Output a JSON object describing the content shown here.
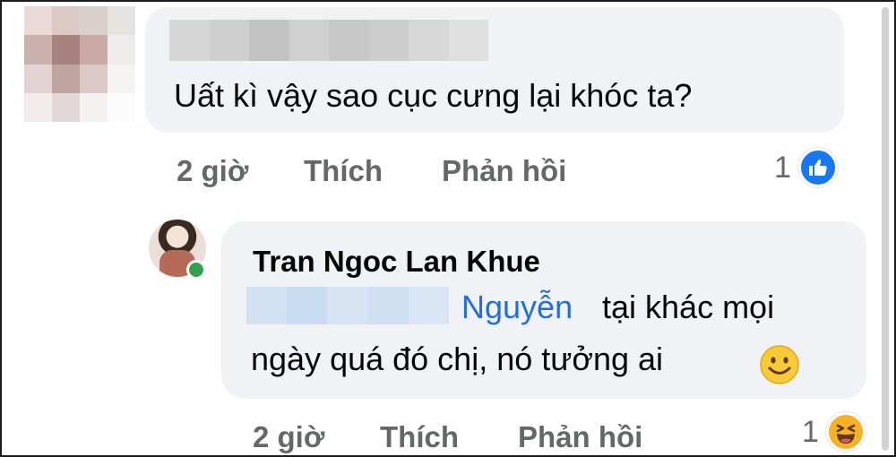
{
  "comment": {
    "text": "Uất kì vậy sao cục cưng lại khóc ta?",
    "time": "2 giờ",
    "like_label": "Thích",
    "reply_label": "Phản hồi",
    "reaction_count": "1",
    "reaction_icon": "like-icon"
  },
  "reply": {
    "author": "Tran Ngoc Lan Khue",
    "mention": "Nguyễn",
    "text_line1": "tại khác mọi",
    "text_line2": "ngày quá đó chị, nó tưởng ai",
    "emoji": "smiling-face-icon",
    "time": "2 giờ",
    "like_label": "Thích",
    "reply_label": "Phản hồi",
    "reaction_count": "1",
    "reaction_icon": "haha-icon",
    "online_status_color": "#31a24c"
  },
  "colors": {
    "bubble": "#f0f2f5",
    "action_text": "#65676b",
    "mention": "#216fdb",
    "like_blue": "#1877f2",
    "haha_yellow": "#f7b125"
  }
}
